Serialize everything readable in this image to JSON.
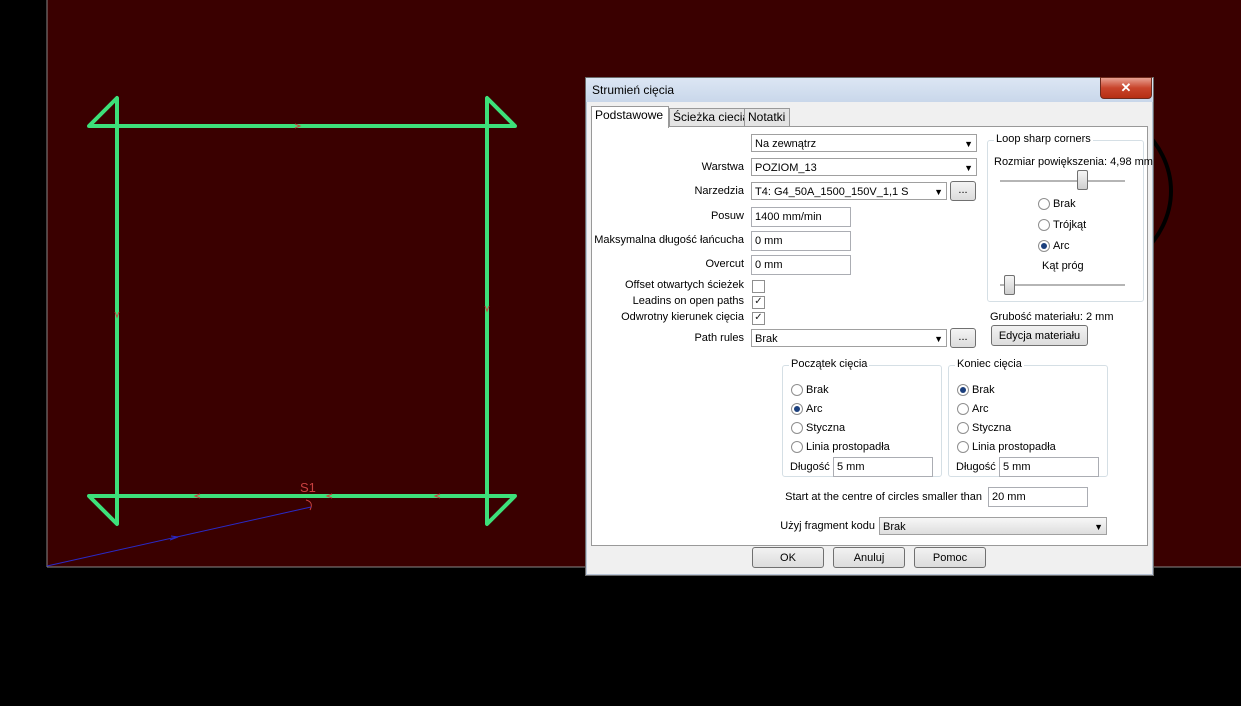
{
  "canvas": {
    "shape_label": "S1"
  },
  "dialog": {
    "title": "Strumień cięcia",
    "close_symbol": "✕",
    "tabs": [
      {
        "label": "Podstawowe",
        "active": true
      },
      {
        "label": "Ścieżka ciecia",
        "active": false
      },
      {
        "label": "Notatki",
        "active": false
      }
    ],
    "form": {
      "side_value": "Na zewnątrz",
      "layer_label": "Warstwa",
      "layer_value": "POZIOM_13",
      "tool_label": "Narzedzia",
      "tool_value": "T4: G4_50A_1500_150V_1,1 S",
      "feed_label": "Posuw",
      "feed_value": "1400 mm/min",
      "maxchain_label": "Maksymalna długość łańcucha",
      "maxchain_value": "0 mm",
      "overcut_label": "Overcut",
      "overcut_value": "0 mm",
      "offset_open_label": "Offset otwartych ścieżek",
      "offset_open_checked": false,
      "leadins_label": "Leadins on open paths",
      "leadins_checked": true,
      "reverse_label": "Odwrotny kierunek cięcia",
      "reverse_checked": true,
      "path_rules_label": "Path rules",
      "path_rules_value": "Brak",
      "dots": "..."
    },
    "loop": {
      "title": "Loop sharp corners",
      "size_label": "Rozmiar powiększenia: 4,98 mm",
      "options": [
        "Brak",
        "Trójkąt",
        "Arc"
      ],
      "selected": "Arc",
      "angle_label": "Kąt próg"
    },
    "material": {
      "thickness_label": "Grubość materiału: 2 mm",
      "edit_button": "Edycja materiału"
    },
    "start": {
      "title": "Początek cięcia",
      "options": [
        "Brak",
        "Arc",
        "Styczna",
        "Linia prostopadła"
      ],
      "selected": "Arc",
      "length_label": "Długość",
      "length_value": "5 mm"
    },
    "end": {
      "title": "Koniec cięcia",
      "options": [
        "Brak",
        "Arc",
        "Styczna",
        "Linia prostopadła"
      ],
      "selected": "Brak",
      "length_label": "Długość",
      "length_value": "5 mm"
    },
    "circles_label": "Start at the centre of circles smaller than",
    "circles_value": "20 mm",
    "code_label": "Użyj fragment kodu",
    "code_value": "Brak",
    "buttons": {
      "ok": "OK",
      "cancel": "Anuluj",
      "help": "Pomoc"
    }
  },
  "colors": {
    "canvas_bg": "#3a0000",
    "shape": "#3de07a",
    "lead_line": "#2a2ac8",
    "marker": "#c84040"
  }
}
